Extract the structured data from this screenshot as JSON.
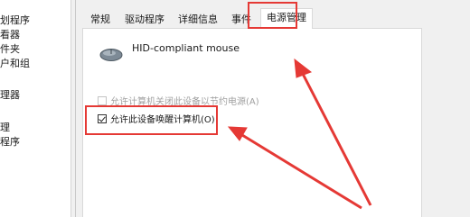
{
  "left_list": [
    "划程序",
    "看器",
    "件夹",
    "户和组",
    "理器",
    "理",
    "程序"
  ],
  "tabs": [
    {
      "label": "常规",
      "active": false
    },
    {
      "label": "驱动程序",
      "active": false
    },
    {
      "label": "详细信息",
      "active": false
    },
    {
      "label": "事件",
      "active": false
    },
    {
      "label": "电源管理",
      "active": true
    }
  ],
  "device": {
    "icon": "mouse-icon",
    "name": "HID-compliant mouse"
  },
  "options": {
    "allow_power_off": {
      "label": "允许计算机关闭此设备以节约电源(A)",
      "checked": false,
      "enabled": false
    },
    "allow_wake": {
      "label": "允许此设备唤醒计算机(O)",
      "checked": true,
      "enabled": true
    }
  },
  "annotation_color": "#e53935"
}
